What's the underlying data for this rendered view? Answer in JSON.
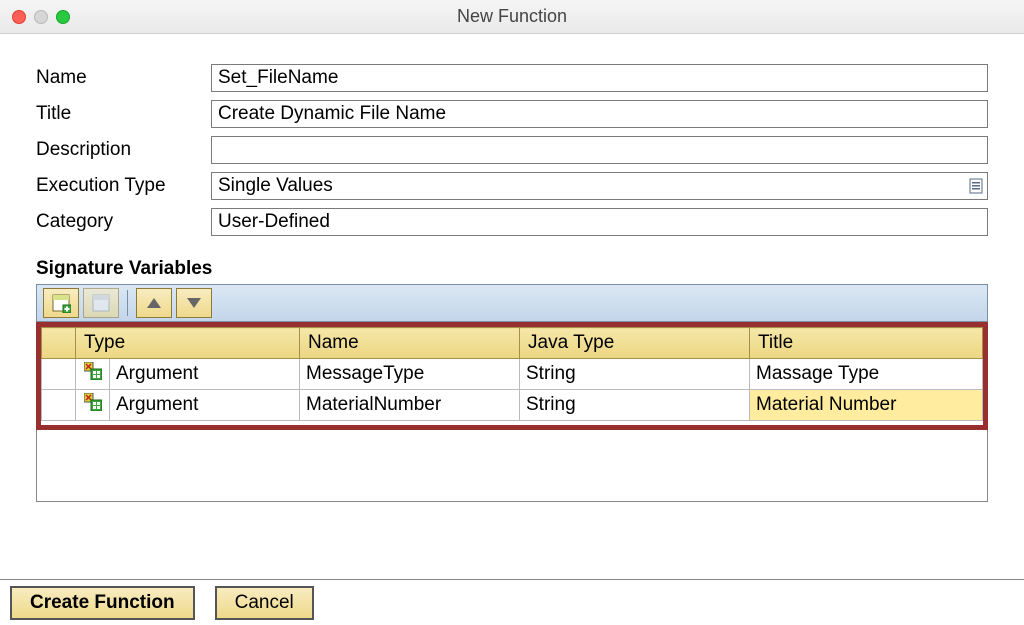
{
  "window": {
    "title": "New Function"
  },
  "form": {
    "labels": {
      "name": "Name",
      "title": "Title",
      "description": "Description",
      "exec_type": "Execution Type",
      "category": "Category"
    },
    "values": {
      "name": "Set_FileName",
      "title": "Create Dynamic File Name",
      "description": "",
      "exec_type": "Single Values",
      "category": "User-Defined"
    }
  },
  "signature": {
    "heading": "Signature Variables",
    "columns": {
      "type": "Type",
      "name": "Name",
      "java_type": "Java Type",
      "title": "Title"
    },
    "rows": [
      {
        "type": "Argument",
        "name": "MessageType",
        "java_type": "String",
        "title": "Massage Type",
        "selected": false
      },
      {
        "type": "Argument",
        "name": "MaterialNumber",
        "java_type": "String",
        "title": "Material Number",
        "selected": true
      }
    ]
  },
  "buttons": {
    "create": "Create Function",
    "cancel": "Cancel"
  }
}
